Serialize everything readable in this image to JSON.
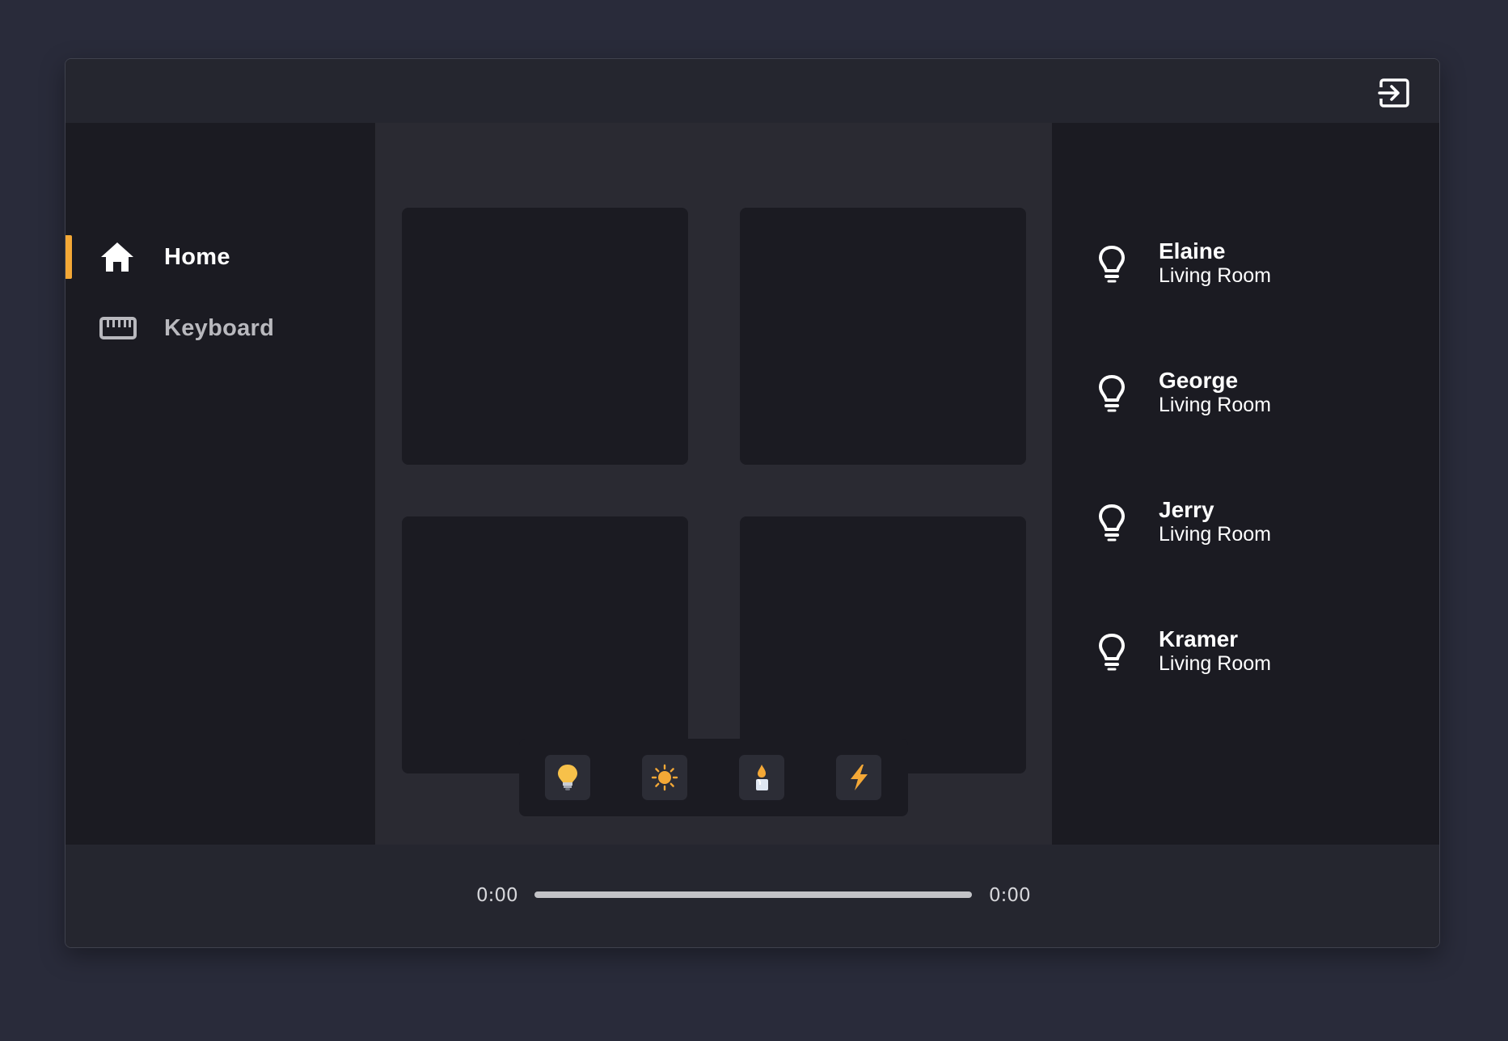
{
  "header": {
    "exit_icon": "exit-to-app-icon"
  },
  "sidebar": {
    "items": [
      {
        "label": "Home",
        "icon": "home-icon",
        "active": true
      },
      {
        "label": "Keyboard",
        "icon": "keyboard-icon",
        "active": false
      }
    ],
    "accent_color": "#f4a836"
  },
  "center": {
    "tiles": [
      {},
      {},
      {},
      {}
    ],
    "effects": [
      {
        "icon": "lightbulb-emoji-icon"
      },
      {
        "icon": "sun-icon"
      },
      {
        "icon": "candle-icon"
      },
      {
        "icon": "lightning-icon"
      }
    ]
  },
  "lights": [
    {
      "name": "Elaine",
      "room": "Living Room",
      "icon": "bulb-outline-icon"
    },
    {
      "name": "George",
      "room": "Living Room",
      "icon": "bulb-outline-icon"
    },
    {
      "name": "Jerry",
      "room": "Living Room",
      "icon": "bulb-outline-icon"
    },
    {
      "name": "Kramer",
      "room": "Living Room",
      "icon": "bulb-outline-icon"
    }
  ],
  "player": {
    "elapsed": "0:00",
    "duration": "0:00",
    "progress": 0
  }
}
